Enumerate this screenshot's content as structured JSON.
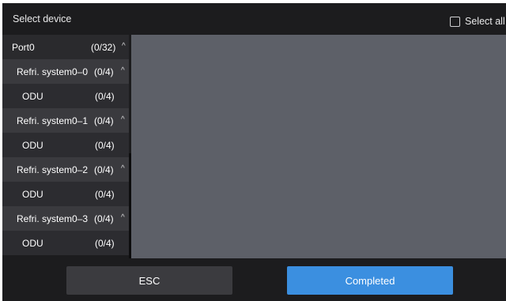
{
  "header": {
    "title": "Select device",
    "select_all_label": "Select all",
    "select_all_checked": false
  },
  "tree": {
    "port": {
      "label": "Port0",
      "count": "(0/32)",
      "chevron": "^"
    },
    "groups": [
      {
        "label": "Refri. system0–0",
        "count": "(0/4)",
        "chevron": "^",
        "children": [
          {
            "label": "ODU",
            "count": "(0/4)"
          }
        ]
      },
      {
        "label": "Refri. system0–1",
        "count": "(0/4)",
        "chevron": "^",
        "children": [
          {
            "label": "ODU",
            "count": "(0/4)"
          }
        ]
      },
      {
        "label": "Refri. system0–2",
        "count": "(0/4)",
        "chevron": "^",
        "children": [
          {
            "label": "ODU",
            "count": "(0/4)"
          }
        ]
      },
      {
        "label": "Refri. system0–3",
        "count": "(0/4)",
        "chevron": "^",
        "children": [
          {
            "label": "ODU",
            "count": "(0/4)"
          }
        ]
      }
    ]
  },
  "footer": {
    "esc_label": "ESC",
    "completed_label": "Completed"
  },
  "colors": {
    "background": "#1c1c1e",
    "content_area": "#5d6068",
    "primary_button": "#3b8fe0",
    "secondary_button": "#3b3b3f"
  }
}
